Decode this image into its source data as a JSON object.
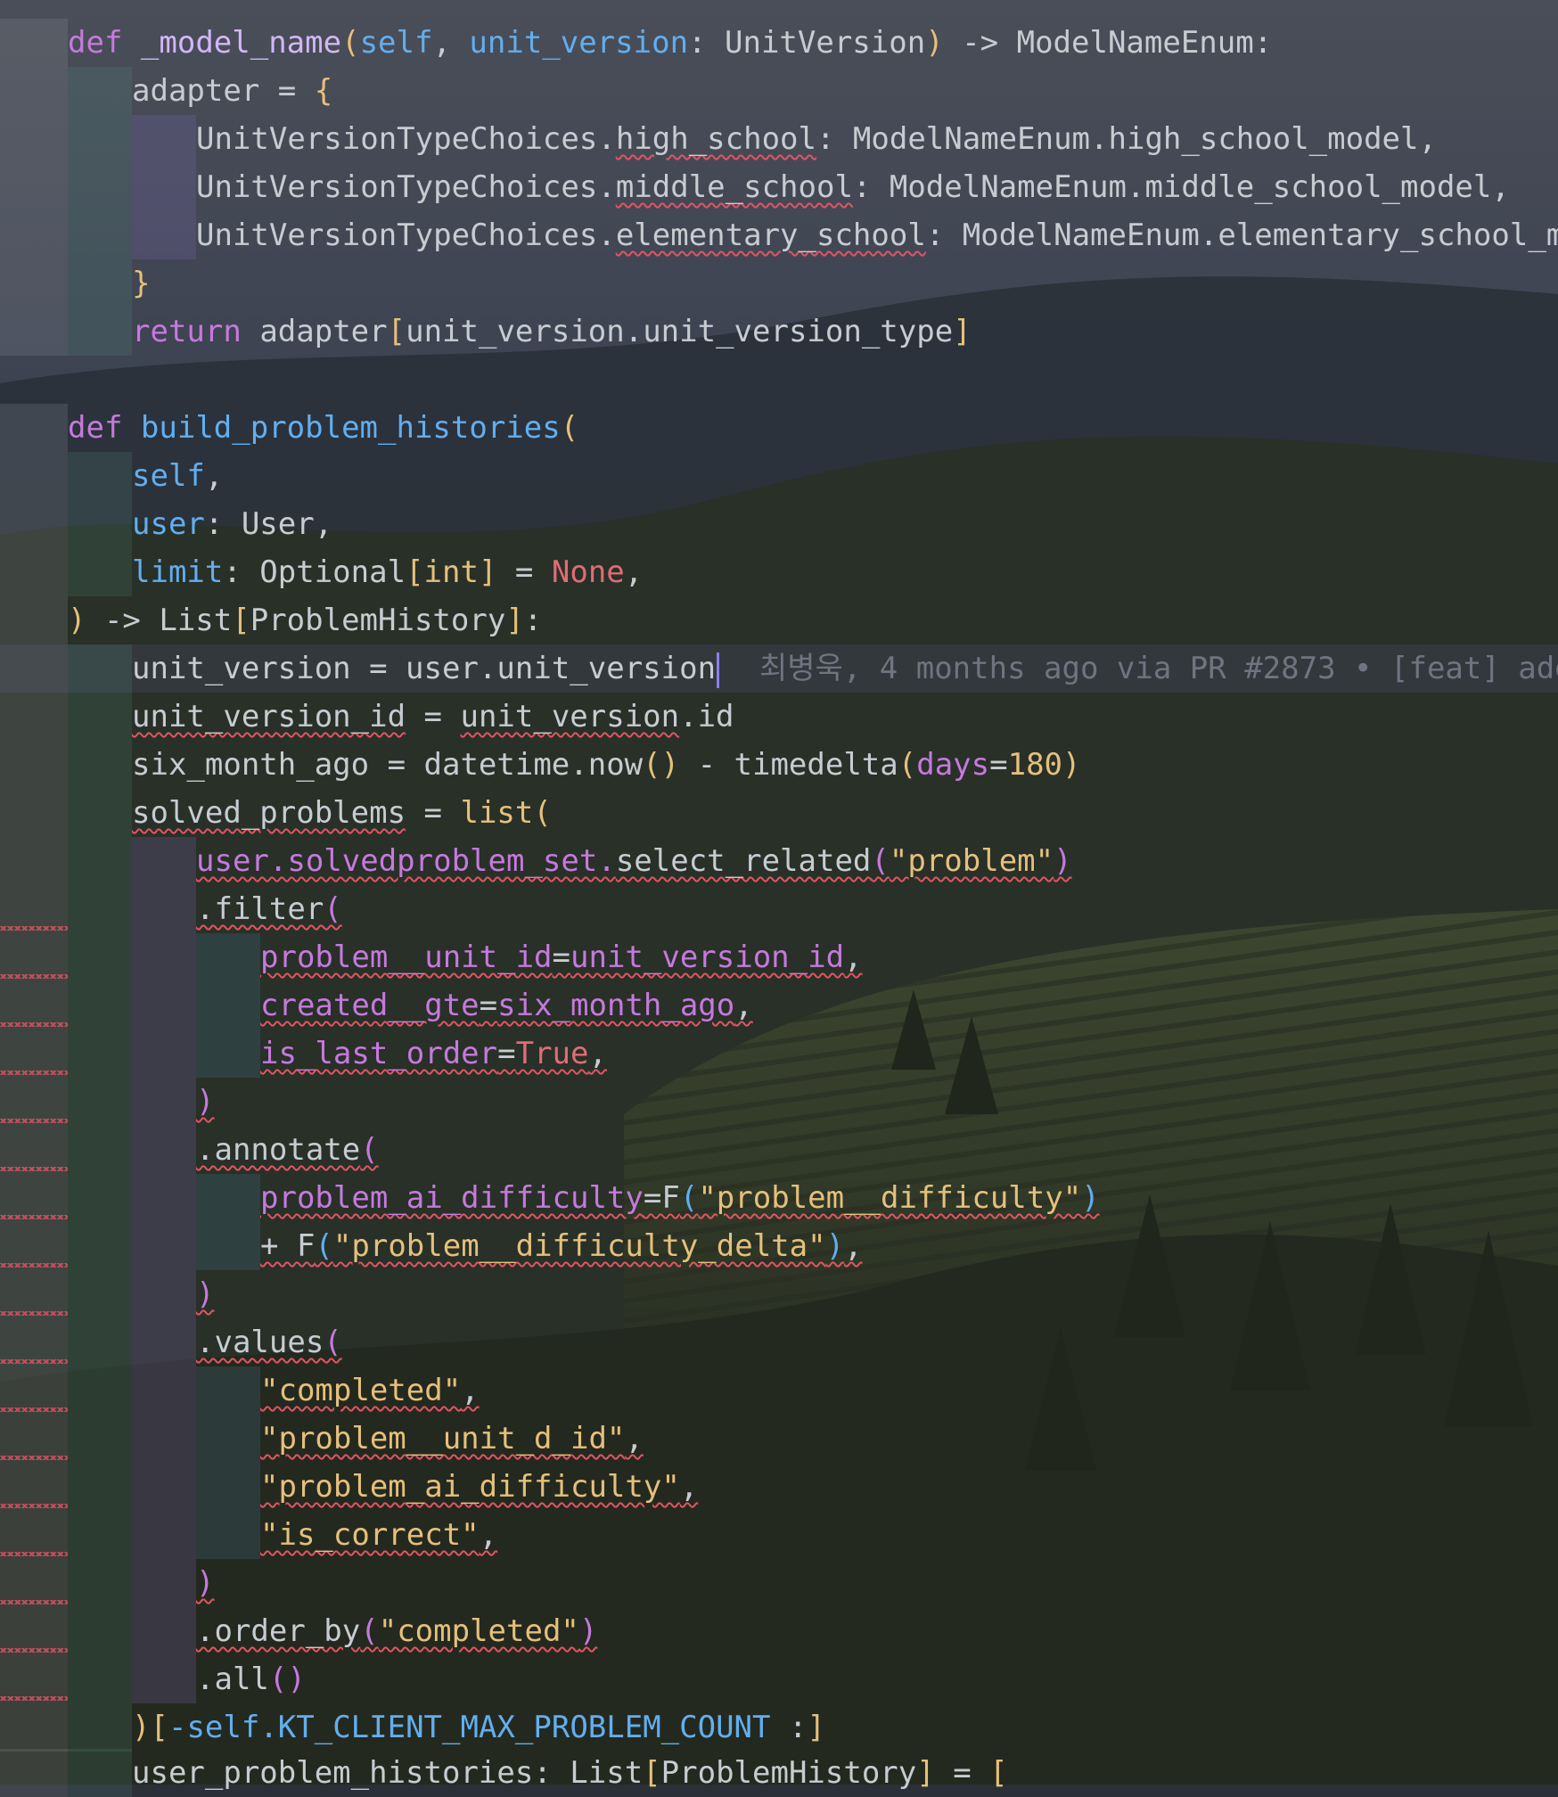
{
  "theme": {
    "keyword_color": "#c679dd",
    "function_color": "#62aeef",
    "string_color": "#e5c07b",
    "constant_color": "#e06c75",
    "text_color": "#c7ccd1",
    "error_squiggle_color": "#e05561",
    "background_image": "landscape-hills-vineyard-pine-trees"
  },
  "blame": {
    "author": "최병욱",
    "when": "4 months ago",
    "via": "via PR #2873",
    "separator": "•",
    "message": "[feat] add dra"
  },
  "code": {
    "l1": {
      "def": "def",
      "name": "_model_name",
      "self": "self",
      "param": "unit_version",
      "colon": ":",
      "type": "UnitVersion",
      "arrow": "->",
      "ret": "ModelNameEnum:"
    },
    "l2": {
      "var": "adapter",
      "eq": "=",
      "open": "{"
    },
    "l3": {
      "cls": "UnitVersionTypeChoices.",
      "attr": "high_school",
      "rest": ": ModelNameEnum.high_school_model,"
    },
    "l4": {
      "cls": "UnitVersionTypeChoices.",
      "attr": "middle_school",
      "rest": ": ModelNameEnum.middle_school_model,"
    },
    "l5": {
      "cls": "UnitVersionTypeChoices.",
      "attr": "elementary_school",
      "rest": ": ModelNameEnum.elementary_school_model,"
    },
    "l6": {
      "close": "}"
    },
    "l7": {
      "kw": "return",
      "var": "adapter",
      "ob": "[",
      "expr": "unit_version.unit_version_type",
      "cb": "]"
    },
    "l9": {
      "def": "def",
      "name": "build_problem_histories",
      "open": "("
    },
    "l10": {
      "self": "self",
      "comma": ","
    },
    "l11": {
      "param": "user",
      "rest": ": User,"
    },
    "l12": {
      "param": "limit",
      "c": ": Optional",
      "ob": "[",
      "int": "int",
      "cb": "]",
      "eq": " = ",
      "none": "None",
      "comma": ","
    },
    "l13": {
      "close": ")",
      "arrow": " -> List",
      "ob": "[",
      "type": "ProblemHistory",
      "cb": "]",
      "colon": ":"
    },
    "l14": {
      "var": "unit_version",
      "eq": " = user.",
      "attr": "unit_version"
    },
    "l15": {
      "var": "unit_version_id",
      "eq": " = ",
      "expr": "unit_version",
      "rest": ".id"
    },
    "l16": {
      "var": "six_month_ago",
      "eq": " = datetime.now",
      "p": "()",
      "minus": " - timedelta",
      "op": "(",
      "kw": "days",
      "eqs": "=",
      "num": "180",
      "cp": ")"
    },
    "l17": {
      "var": "solved_problems",
      "eq": " = ",
      "fn": "list",
      "op": "("
    },
    "l18": {
      "obj": "user.solvedproblem_set.",
      "m": "select_related",
      "op": "(",
      "s": "\"problem\"",
      "cp": ")"
    },
    "l19": {
      "m": ".filter",
      "op": "("
    },
    "l20": {
      "kw": "problem__unit_id",
      "eq": "=",
      "val": "unit_version_id",
      "comma": ","
    },
    "l21": {
      "kw": "created__gte",
      "eq": "=",
      "val": "six_month_ago",
      "comma": ","
    },
    "l22": {
      "kw": "is_last_order",
      "eq": "=",
      "val": "True",
      "comma": ","
    },
    "l23": {
      "cp": ")"
    },
    "l24": {
      "m": ".annotate",
      "op": "("
    },
    "l25": {
      "kw": "problem_ai_difficulty",
      "eq": "=F",
      "op": "(",
      "s": "\"problem__difficulty\"",
      "cp": ")"
    },
    "l26": {
      "plus": "+ F",
      "op": "(",
      "s": "\"problem__difficulty_delta\"",
      "cp": ")",
      "comma": ","
    },
    "l27": {
      "cp": ")"
    },
    "l28": {
      "m": ".values",
      "op": "("
    },
    "l29": {
      "s": "\"completed\"",
      "comma": ","
    },
    "l30": {
      "s": "\"problem__unit_d_id\"",
      "comma": ","
    },
    "l31": {
      "s": "\"problem_ai_difficulty\"",
      "comma": ","
    },
    "l32": {
      "s": "\"is_correct\"",
      "comma": ","
    },
    "l33": {
      "cp": ")"
    },
    "l34": {
      "m": ".order_by",
      "op": "(",
      "s": "\"completed\"",
      "cp": ")"
    },
    "l35": {
      "m": ".all",
      "p": "()"
    },
    "l36": {
      "cp": ")",
      "ob": "[",
      "neg": "-self.",
      "const": "KT_CLIENT_MAX_PROBLEM_COUNT",
      "colon": " :",
      "cb": "]"
    },
    "l37": {
      "var": "user_problem_histories",
      "c": ": List",
      "ob": "[",
      "type": "ProblemHistory",
      "cb": "]",
      "eq": " = ",
      "open": "["
    }
  }
}
